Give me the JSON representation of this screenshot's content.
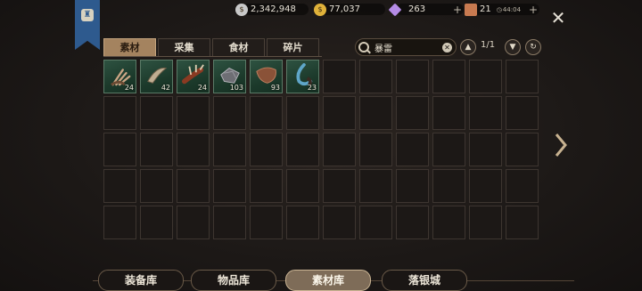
{
  "resources": {
    "silver": "2,342,948",
    "gold": "77,037",
    "gems": "263",
    "stamina": "21",
    "timer": "44:04"
  },
  "tabs": [
    {
      "label": "素材",
      "active": true
    },
    {
      "label": "采集",
      "active": false
    },
    {
      "label": "食材",
      "active": false
    },
    {
      "label": "碎片",
      "active": false
    }
  ],
  "search": {
    "value": "暴雷"
  },
  "pagination": {
    "text": "1/1"
  },
  "items": [
    {
      "icon": "claw-icon",
      "qty": "24"
    },
    {
      "icon": "fang-icon",
      "qty": "42"
    },
    {
      "icon": "spiked-claw-icon",
      "qty": "24"
    },
    {
      "icon": "scale-icon",
      "qty": "103"
    },
    {
      "icon": "hide-icon",
      "qty": "93"
    },
    {
      "icon": "blue-tusk-icon",
      "qty": "23"
    }
  ],
  "bottom_tabs": [
    {
      "label": "装备库",
      "active": false
    },
    {
      "label": "物品库",
      "active": false
    },
    {
      "label": "素材库",
      "active": true
    },
    {
      "label": "落银城",
      "active": false
    }
  ],
  "colors": {
    "banner": "#2e5a8e",
    "tab_active": "#a4835f",
    "slot_filled": "#2a4a3a"
  }
}
